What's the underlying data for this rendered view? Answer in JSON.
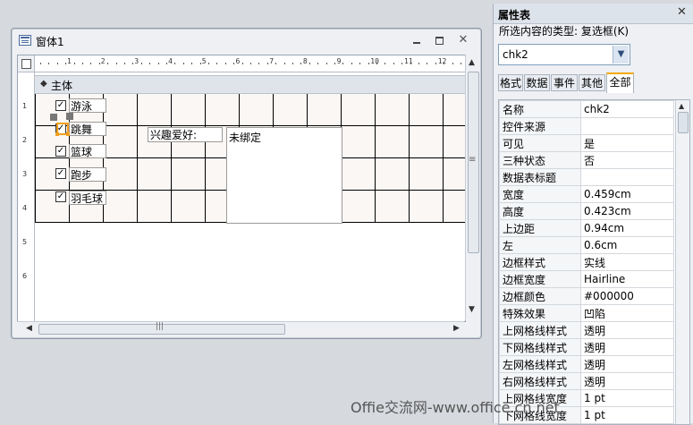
{
  "form": {
    "title": "窗体1",
    "ruler_marks": [
      "1",
      "2",
      "3",
      "4",
      "5",
      "6",
      "7",
      "8",
      "9",
      "10",
      "11",
      "12"
    ],
    "vruler_marks": [
      "1",
      "2",
      "3",
      "4",
      "5",
      "6"
    ],
    "section_label": "主体",
    "checkboxes": [
      {
        "label": "游泳",
        "checked": true
      },
      {
        "label": "跳舞",
        "checked": true
      },
      {
        "label": "篮球",
        "checked": true
      },
      {
        "label": "跑步",
        "checked": true
      },
      {
        "label": "羽毛球",
        "checked": true
      }
    ],
    "hobby_label": "兴趣爱好:",
    "unbound_text": "未绑定"
  },
  "property_sheet": {
    "title": "属性表",
    "selection_type": "所选内容的类型: 复选框(K)",
    "selected_control": "chk2",
    "tabs": [
      "格式",
      "数据",
      "事件",
      "其他",
      "全部"
    ],
    "active_tab": "全部",
    "rows": [
      {
        "name": "名称",
        "value": "chk2"
      },
      {
        "name": "控件来源",
        "value": ""
      },
      {
        "name": "可见",
        "value": "是"
      },
      {
        "name": "三种状态",
        "value": "否"
      },
      {
        "name": "数据表标题",
        "value": ""
      },
      {
        "name": "宽度",
        "value": "0.459cm"
      },
      {
        "name": "高度",
        "value": "0.423cm"
      },
      {
        "name": "上边距",
        "value": "0.94cm"
      },
      {
        "name": "左",
        "value": "0.6cm"
      },
      {
        "name": "边框样式",
        "value": "实线"
      },
      {
        "name": "边框宽度",
        "value": "Hairline"
      },
      {
        "name": "边框颜色",
        "value": "#000000"
      },
      {
        "name": "特殊效果",
        "value": "凹陷"
      },
      {
        "name": "上网格线样式",
        "value": "透明"
      },
      {
        "name": "下网格线样式",
        "value": "透明"
      },
      {
        "name": "左网格线样式",
        "value": "透明"
      },
      {
        "name": "右网格线样式",
        "value": "透明"
      },
      {
        "name": "上网格线宽度",
        "value": "1 pt"
      },
      {
        "name": "下网格线宽度",
        "value": "1 pt"
      }
    ]
  },
  "watermark": "Offie交流网-www.office.cn.net",
  "colors": {
    "tab_accent": "#f2a900",
    "selection": "#f0a020"
  }
}
